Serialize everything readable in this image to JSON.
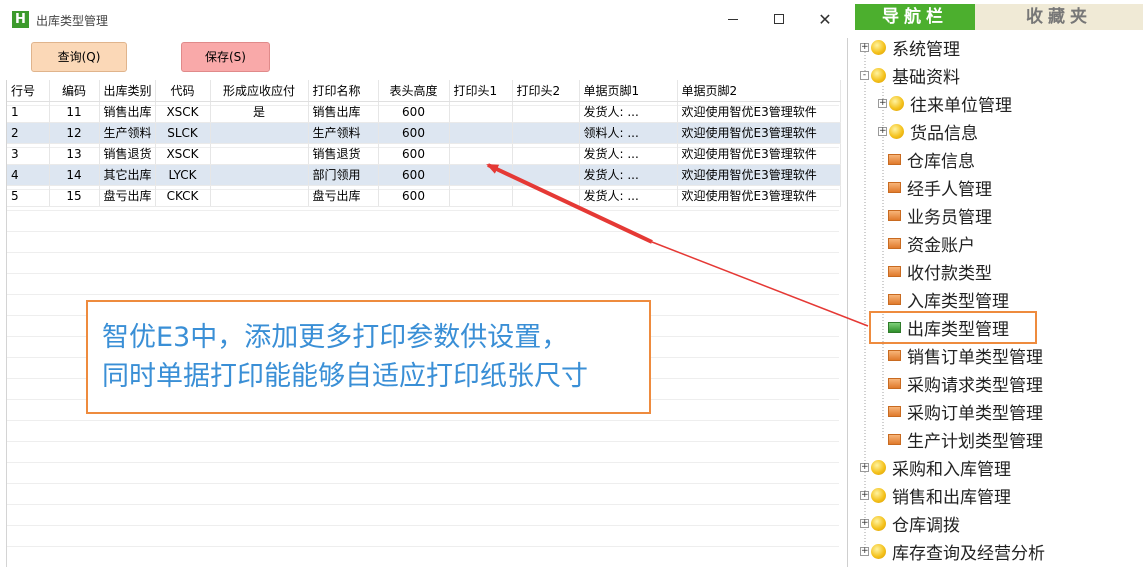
{
  "window": {
    "logo_letter": "H",
    "title": "出库类型管理",
    "close_glyph": "✕"
  },
  "toolbar": {
    "query_label": "查询(Q)",
    "save_label": "保存(S)"
  },
  "table": {
    "columns": [
      "行号",
      "编码",
      "出库类别",
      "代码",
      "形成应收应付",
      "打印名称",
      "表头高度",
      "打印头1",
      "打印头2",
      "单据页脚1",
      "单据页脚2"
    ],
    "rows": [
      [
        "1",
        "11",
        "销售出库",
        "XSCK",
        "是",
        "销售出库",
        "600",
        "",
        "",
        "发货人: ...",
        "欢迎使用智优E3管理软件"
      ],
      [
        "2",
        "12",
        "生产领料",
        "SLCK",
        "",
        "生产领料",
        "600",
        "",
        "",
        "领料人: ...",
        "欢迎使用智优E3管理软件"
      ],
      [
        "3",
        "13",
        "销售退货",
        "XSCK",
        "",
        "销售退货",
        "600",
        "",
        "",
        "发货人: ...",
        "欢迎使用智优E3管理软件"
      ],
      [
        "4",
        "14",
        "其它出库",
        "LYCK",
        "",
        "部门领用",
        "600",
        "",
        "",
        "发货人: ...",
        "欢迎使用智优E3管理软件"
      ],
      [
        "5",
        "15",
        "盘亏出库",
        "CKCK",
        "",
        "盘亏出库",
        "600",
        "",
        "",
        "发货人: ...",
        "欢迎使用智优E3管理软件"
      ]
    ]
  },
  "annotation": {
    "line1": "智优E3中，添加更多打印参数供设置，",
    "line2": "同时单据打印能能够自适应打印纸张尺寸"
  },
  "nav": {
    "tab_nav": "导航栏",
    "tab_fav": "收藏夹",
    "items": [
      {
        "label": "系统管理",
        "level": 0,
        "icon": "folder-icon",
        "expander": "+"
      },
      {
        "label": "基础资料",
        "level": 0,
        "icon": "folder-icon",
        "expander": "-"
      },
      {
        "label": "往来单位管理",
        "level": 1,
        "icon": "folder-icon",
        "expander": "+"
      },
      {
        "label": "货品信息",
        "level": 1,
        "icon": "folder-icon",
        "expander": "+"
      },
      {
        "label": "仓库信息",
        "level": 1,
        "icon": "leaf-icon"
      },
      {
        "label": "经手人管理",
        "level": 1,
        "icon": "leaf-icon"
      },
      {
        "label": "业务员管理",
        "level": 1,
        "icon": "leaf-icon"
      },
      {
        "label": "资金账户",
        "level": 1,
        "icon": "leaf-icon"
      },
      {
        "label": "收付款类型",
        "level": 1,
        "icon": "leaf-icon"
      },
      {
        "label": "入库类型管理",
        "level": 1,
        "icon": "leaf-icon"
      },
      {
        "label": "出库类型管理",
        "level": 1,
        "icon": "leaf-icon-green",
        "selected": true
      },
      {
        "label": "销售订单类型管理",
        "level": 1,
        "icon": "leaf-icon"
      },
      {
        "label": "采购请求类型管理",
        "level": 1,
        "icon": "leaf-icon"
      },
      {
        "label": "采购订单类型管理",
        "level": 1,
        "icon": "leaf-icon"
      },
      {
        "label": "生产计划类型管理",
        "level": 1,
        "icon": "leaf-icon"
      },
      {
        "label": "采购和入库管理",
        "level": 0,
        "icon": "folder-icon",
        "expander": "+"
      },
      {
        "label": "销售和出库管理",
        "level": 0,
        "icon": "folder-icon",
        "expander": "+"
      },
      {
        "label": "仓库调拨",
        "level": 0,
        "icon": "folder-icon",
        "expander": "+"
      },
      {
        "label": "库存查询及经营分析",
        "level": 0,
        "icon": "folder-icon",
        "expander": "+"
      }
    ]
  },
  "colors": {
    "accent_orange": "#ee8b3e",
    "arrow_red": "#e53935",
    "annotation_blue": "#3a8fd6",
    "nav_green": "#4caf2e"
  }
}
